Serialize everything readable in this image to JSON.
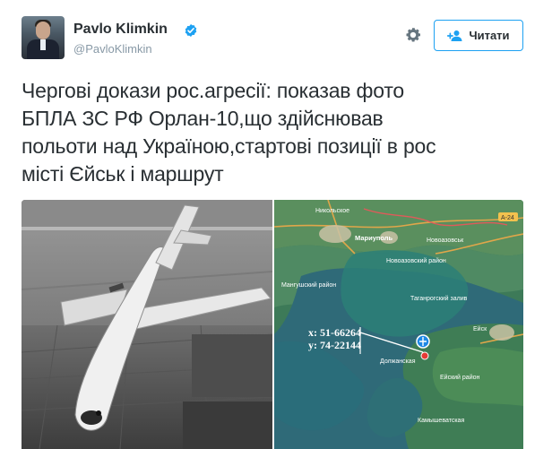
{
  "tweet": {
    "author_name": "Pavlo Klimkin",
    "author_handle": "@PavloKlimkin",
    "follow_label": "Читати",
    "text_lines": [
      "Чергові докази рос.агресії: показав фото",
      "БПЛА ЗС РФ Орлан-10,що здійснював",
      "польоти над Україною,стартові позиції в рос",
      "місті Єйськ і маршрут"
    ]
  },
  "media": {
    "photo_left": {
      "subject": "drone-photo"
    },
    "photo_right": {
      "subject": "route-map",
      "coord_x": "x: 51-66264",
      "coord_y": "y: 74-22144",
      "map_labels": {
        "nikolskoe": "Никольское",
        "mariupol": "Мариуполь",
        "novoazovsk": "Новоазовськ",
        "novoazovsky_rayon": "Новоазовский район",
        "mangushsky_rayon": "Мангушский район",
        "taganrog_bay": "Таганрогский залив",
        "yeysk": "Ейск",
        "dolzhanskaya": "Должанская",
        "yeysky_rayon": "Ейский район",
        "kamyshevatskaya": "Камышеватская",
        "a24": "A-24"
      }
    }
  },
  "colors": {
    "accent": "#1da1f2",
    "text": "#292f33",
    "muted": "#8899a6",
    "verified": "#1da1f2"
  }
}
